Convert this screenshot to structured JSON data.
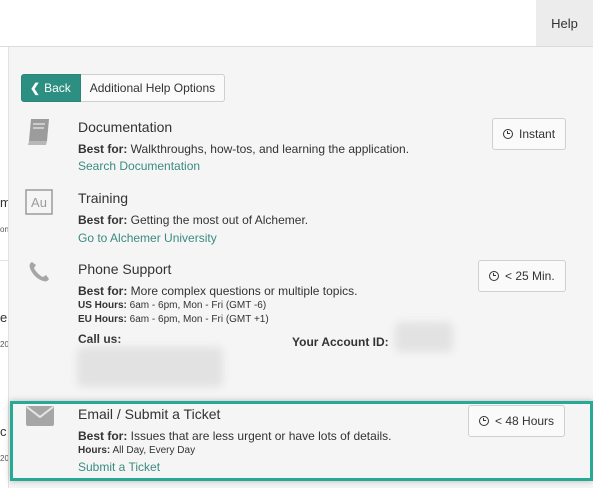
{
  "topbar": {
    "help_tab": "Help"
  },
  "left_fragments": [
    "m",
    "on",
    "e",
    "20",
    "c",
    "20"
  ],
  "nav": {
    "back_label": "Back",
    "more_label": "Additional Help Options"
  },
  "sections": {
    "documentation": {
      "icon": "book-icon",
      "title": "Documentation",
      "best_label": "Best for:",
      "best_text": " Walkthroughs, how-tos, and learning the application.",
      "link": "Search Documentation",
      "badge": "Instant"
    },
    "training": {
      "icon": "alchemer-university-icon",
      "icon_text": "Au",
      "title": "Training",
      "best_label": "Best for:",
      "best_text": " Getting the most out of Alchemer.",
      "link": "Go to Alchemer University"
    },
    "phone": {
      "icon": "phone-icon",
      "title": "Phone Support",
      "best_label": "Best for:",
      "best_text": " More complex questions or multiple topics.",
      "us_label": "US Hours:",
      "us_text": " 6am - 6pm, Mon - Fri (GMT -6)",
      "eu_label": "EU Hours:",
      "eu_text": " 6am - 6pm, Mon - Fri (GMT +1)",
      "call_label": "Call us:",
      "account_label": "Your Account ID:",
      "badge": "< 25 Min."
    },
    "email": {
      "icon": "envelope-icon",
      "title": "Email / Submit a Ticket",
      "best_label": "Best for:",
      "best_text": " Issues that are less urgent or have lots of details.",
      "hours_label": "Hours:",
      "hours_text": " All Day, Every Day",
      "link": "Submit a Ticket",
      "badge": "< 48 Hours"
    }
  },
  "colors": {
    "accent": "#2d8e82",
    "highlight": "#27a995",
    "link": "#3a8b80",
    "panel": "#f5f5f5"
  }
}
